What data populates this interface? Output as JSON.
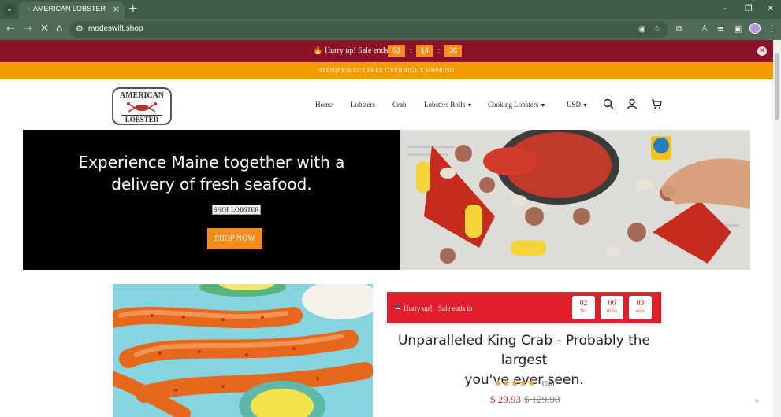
{
  "browser": {
    "tab_title": "AMERICAN LOBSTER",
    "url": "modeswift.shop",
    "tab_menu_glyph": "⌄",
    "new_tab_glyph": "+",
    "close_glyph": "×"
  },
  "announcement": {
    "text": "🔥 Hurry up! Sale ends in",
    "hours": "03",
    "minutes": "14",
    "seconds": "36",
    "separator": ":"
  },
  "shipping_banner": {
    "text": "SPEND $50 GET FREE OVERNIGHT SHIPPING"
  },
  "logo": {
    "top": "AMERICAN",
    "bottom": "LOBSTER"
  },
  "nav": {
    "home": "Home",
    "lobsters": "Lobsters",
    "crab": "Crab",
    "lobster_rolls": "Lobsters Rolls",
    "cooking_lobsters": "Cooking Lobsters",
    "currency": "USD"
  },
  "hero": {
    "title_line1": "Experience Maine together with a",
    "title_line2": "delivery of fresh seafood.",
    "link_text": "SHOP LOBSTER",
    "button_label": "SHOP NOW"
  },
  "sale": {
    "text": "Hurry up！ Sale ends in",
    "hrs": "02",
    "hrs_label": "hrs",
    "mins": "06",
    "mins_label": "mins",
    "secs": "03",
    "secs_label": "secs"
  },
  "product": {
    "title_line1": "Unparalleled King Crab - Probably the largest",
    "title_line2": "you've ever seen.",
    "stars": "★★★★★",
    "rating": "(5.0)",
    "price": "$ 29.93",
    "compare_price": "$ 129.98"
  },
  "colors": {
    "announcement_bg": "#8b1226",
    "accent_orange": "#f28c1b",
    "shipping_bg": "#f59a00",
    "sale_red": "#e11f2c"
  }
}
